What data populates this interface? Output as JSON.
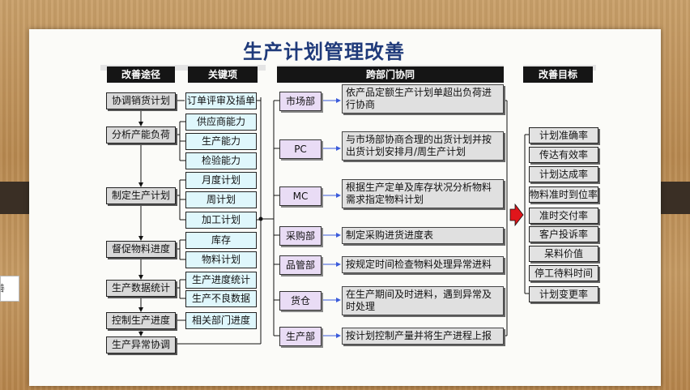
{
  "title": "生产计划管理改善",
  "headers": {
    "approach": "改善途径",
    "keys": "关键项",
    "cross": "跨部门协同",
    "goals": "改善目标"
  },
  "approaches": [
    "协调销货计划",
    "分析产能负荷",
    "制定生产计划",
    "督促物料进度",
    "生产数据统计",
    "控制生产进度",
    "生产异常协调"
  ],
  "keys": [
    "订单评审及插单",
    "供应商能力",
    "生产能力",
    "检验能力",
    "月度计划",
    "周计划",
    "加工计划",
    "库存",
    "物料计划",
    "生产进度统计",
    "生产不良数据",
    "相关部门进度"
  ],
  "departments": [
    {
      "name": "市场部",
      "desc": "依产品定额生产计划单超出负荷进行协商"
    },
    {
      "name": "PC",
      "desc": "与市场部协商合理的出货计划并按出货计划安排月/周生产计划"
    },
    {
      "name": "MC",
      "desc": "根据生产定单及库存状况分析物料需求指定物料计划"
    },
    {
      "name": "采购部",
      "desc": "制定采购进货进度表"
    },
    {
      "name": "品管部",
      "desc": "按规定时间检查物料处理异常进料"
    },
    {
      "name": "货仓",
      "desc": "在生产期间及时进料，遇到异常及时处理"
    },
    {
      "name": "生产部",
      "desc": "按计划控制产量并将生产进程上报"
    }
  ],
  "goals": [
    "计划准确率",
    "传达有效率",
    "计划达成率",
    "物料准时到位率",
    "准时交付率",
    "客户投诉率",
    "呆料价值",
    "停工待料时间",
    "计划变更率"
  ],
  "side_note": "善",
  "colors": {
    "title": "#1f3a7a",
    "arrow_red": "#e0151b",
    "line_blue": "#3b5bdb"
  }
}
